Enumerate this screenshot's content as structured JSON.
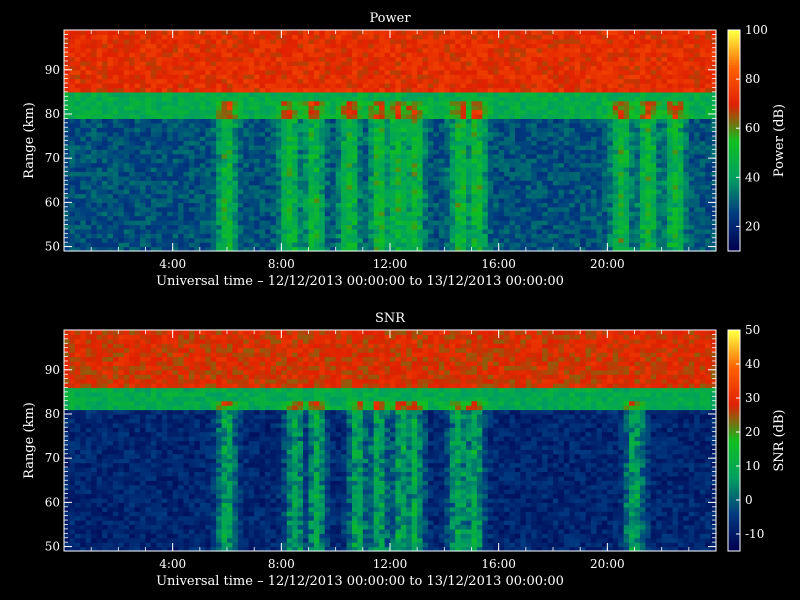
{
  "chart_data": [
    {
      "type": "heatmap",
      "title": "Power",
      "xlabel": "Universal time – 12/12/2013 00:00:00 to 13/12/2013 00:00:00",
      "ylabel": "Range (km)",
      "xlim_hours": [
        0,
        24
      ],
      "xticks": [
        "4:00",
        "8:00",
        "12:00",
        "16:00",
        "20:00"
      ],
      "xtick_hours": [
        4,
        8,
        12,
        16,
        20
      ],
      "ylim": [
        49,
        99
      ],
      "yticks": [
        50,
        60,
        70,
        80,
        90
      ],
      "colorbar": {
        "label": "Power (dB)",
        "range": [
          10,
          100
        ],
        "ticks": [
          20,
          40,
          60,
          80,
          100
        ]
      },
      "colormap": [
        "#000050",
        "#003a80",
        "#00a060",
        "#10c020",
        "#e02000",
        "#ff6000",
        "#ffff40"
      ],
      "grid": false,
      "layers": [
        {
          "range_km": [
            49,
            79
          ],
          "value": 28,
          "description_level": "noise"
        },
        {
          "range_km": [
            79,
            85
          ],
          "value": 45
        },
        {
          "range_km": [
            85,
            99
          ],
          "value": 72
        }
      ],
      "disturbances_hours": [
        6,
        8.3,
        9.2,
        10.5,
        11.6,
        12.3,
        12.9,
        14.6,
        15.2,
        20.5,
        21.5,
        22.5
      ]
    },
    {
      "type": "heatmap",
      "title": "SNR",
      "xlabel": "Universal time – 12/12/2013 00:00:00 to 13/12/2013 00:00:00",
      "ylabel": "Range (km)",
      "xlim_hours": [
        0,
        24
      ],
      "xticks": [
        "4:00",
        "8:00",
        "12:00",
        "16:00",
        "20:00"
      ],
      "xtick_hours": [
        4,
        8,
        12,
        16,
        20
      ],
      "ylim": [
        49,
        99
      ],
      "yticks": [
        50,
        60,
        70,
        80,
        90
      ],
      "colorbar": {
        "label": "SNR (dB)",
        "range": [
          -15,
          50
        ],
        "ticks": [
          -10,
          0,
          10,
          20,
          30,
          40,
          50
        ]
      },
      "colormap": [
        "#000050",
        "#003a80",
        "#00a060",
        "#10c020",
        "#e02000",
        "#ff6000",
        "#ffff40"
      ],
      "grid": false,
      "layers": [
        {
          "range_km": [
            49,
            81
          ],
          "value": -8
        },
        {
          "range_km": [
            81,
            86
          ],
          "value": 10
        },
        {
          "range_km": [
            86,
            99
          ],
          "value": 28
        }
      ],
      "disturbances_hours": [
        6,
        8.5,
        9.3,
        10.8,
        11.6,
        12.4,
        12.9,
        14.5,
        15.1,
        21
      ]
    }
  ]
}
